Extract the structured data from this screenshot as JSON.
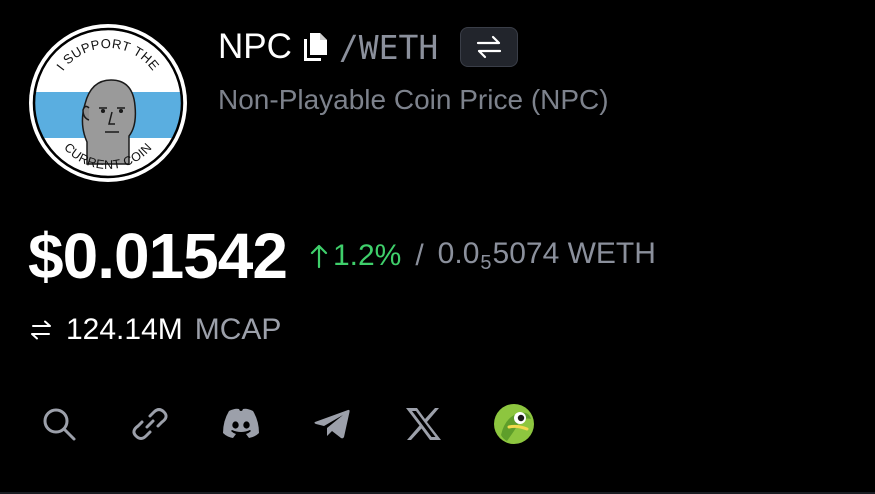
{
  "token": {
    "logo": {
      "icon": "npc-wojak-logo",
      "text_top": "I SUPPORT THE",
      "text_bottom": "CURRENT COIN"
    },
    "symbol": "NPC",
    "quote": "/WETH",
    "full_name": "Non-Playable Coin Price (NPC)"
  },
  "price": {
    "usd": "$0.01542",
    "change": "1.2%",
    "separator": "/",
    "weth_prefix": "0.0",
    "weth_zero_count": "5",
    "weth_suffix": "5074 WETH"
  },
  "mcap": {
    "value": "124.14M",
    "label": "MCAP"
  },
  "links": [
    {
      "icon": "search-icon"
    },
    {
      "icon": "link-icon"
    },
    {
      "icon": "discord-icon"
    },
    {
      "icon": "telegram-icon"
    },
    {
      "icon": "x-icon"
    },
    {
      "icon": "coingecko-icon"
    }
  ],
  "colors": {
    "background": "#000000",
    "positive": "#3fcf6b",
    "muted": "#8b909c",
    "text": "#ffffff",
    "logo_band": "#5aaee0",
    "coingecko": "#8dc63f"
  }
}
